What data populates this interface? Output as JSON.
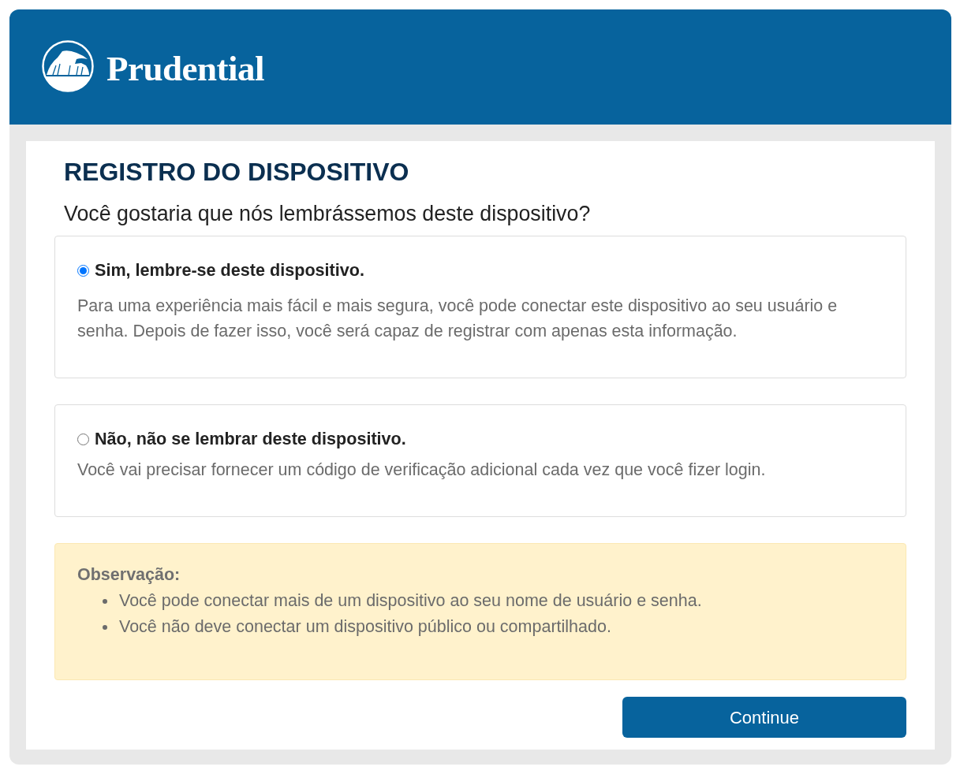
{
  "header": {
    "logo_text": "Prudential"
  },
  "page": {
    "title": "REGISTRO DO DISPOSITIVO",
    "question": "Você gostaria que nós lembrássemos deste dispositivo?"
  },
  "options": [
    {
      "label": "Sim, lembre-se deste dispositivo.",
      "description": "Para uma experiência mais fácil e mais segura, você pode conectar este dispositivo ao seu usuário e senha. Depois de fazer isso, você será capaz de registrar com apenas esta informação.",
      "selected": true
    },
    {
      "label": "Não, não se lembrar deste dispositivo.",
      "description": "Você vai precisar fornecer um código de verificação adicional cada vez que você fizer login.",
      "selected": false
    }
  ],
  "note": {
    "title": "Observação:",
    "items": [
      "Você pode conectar mais de um dispositivo ao seu nome de usuário e senha.",
      "Você não deve conectar um dispositivo público ou compartilhado."
    ]
  },
  "button": {
    "label": "Continue"
  }
}
